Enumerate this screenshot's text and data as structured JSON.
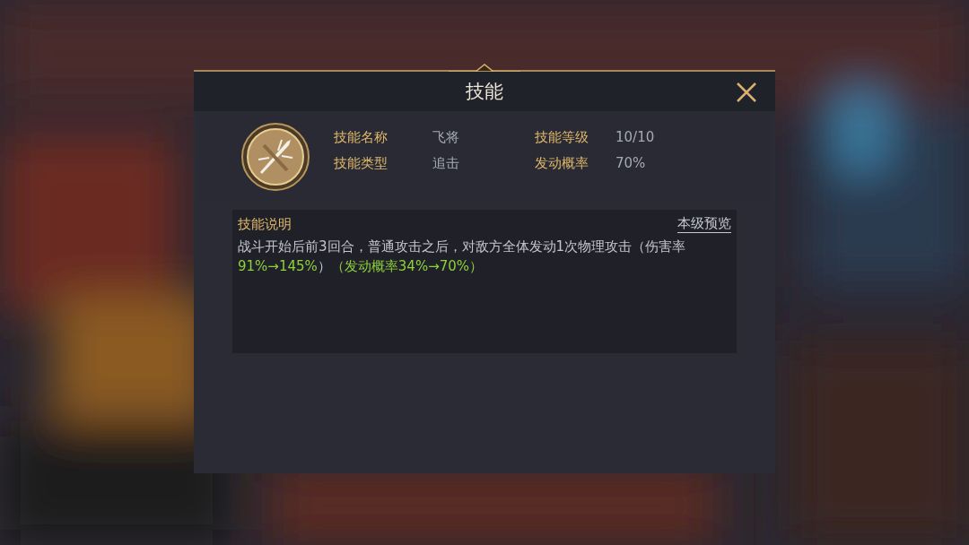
{
  "dialog": {
    "title": "技能"
  },
  "skill": {
    "fields": [
      {
        "label": "技能名称",
        "value": "飞将"
      },
      {
        "label": "技能等级",
        "value": "10/10"
      },
      {
        "label": "技能类型",
        "value": "追击"
      },
      {
        "label": "发动概率",
        "value": "70%"
      }
    ]
  },
  "description": {
    "heading": "技能说明",
    "preview_link": "本级预览",
    "segments": [
      {
        "text": "战斗开始后前3回合，普通攻击之后，对敌方全体发动1次物理攻击（伤害率",
        "highlight": false
      },
      {
        "text": "91%→145%",
        "highlight": true
      },
      {
        "text": "）",
        "highlight": false
      },
      {
        "text": "（发动概率34%→70%）",
        "highlight": true
      }
    ]
  }
}
